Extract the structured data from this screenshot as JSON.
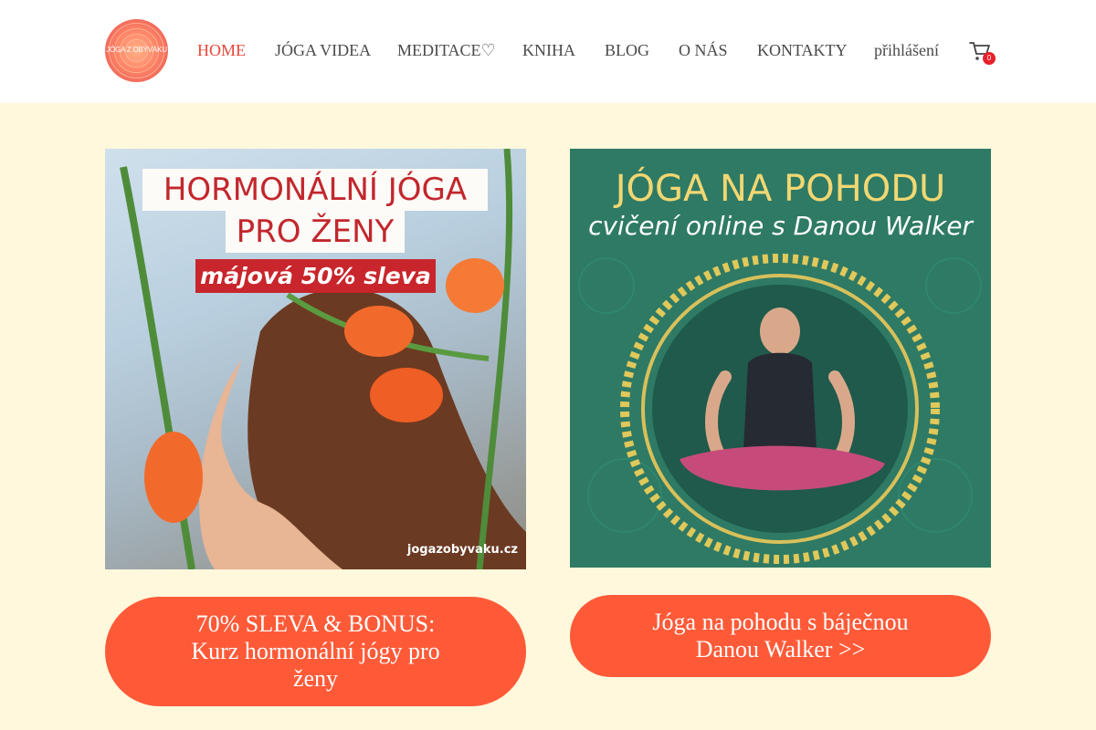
{
  "header": {
    "logo_text": "JÓGA Z OBÝVÁKU",
    "nav": [
      {
        "label": "HOME",
        "active": true
      },
      {
        "label": "JÓGA VIDEA"
      },
      {
        "label": "MEDITACE♡"
      },
      {
        "label": "KNIHA"
      },
      {
        "label": "BLOG"
      },
      {
        "label": "O NÁS"
      },
      {
        "label": "KONTAKTY"
      },
      {
        "label": "přihlášení"
      }
    ],
    "cart_count": "0",
    "cart_icon": "cart-icon"
  },
  "cards": {
    "left": {
      "title_line1": "HORMONÁLNÍ JÓGA",
      "title_line2": "PRO ŽENY",
      "sale": "májová 50% sleva",
      "domain": "jogazobyvaku.cz",
      "cta": "70% SLEVA & BONUS: Kurz hormonální jógy pro ženy"
    },
    "right": {
      "title": "JÓGA NA POHODU",
      "subtitle": "cvičení online s Danou Walker",
      "cta": "Jóga na pohodu s báječnou Danou Walker >>"
    }
  },
  "colors": {
    "page_bg": "#fff8dc",
    "accent": "#e8473b",
    "button": "#ff5a38",
    "teal": "#2e7a65",
    "gold": "#f2d772"
  }
}
